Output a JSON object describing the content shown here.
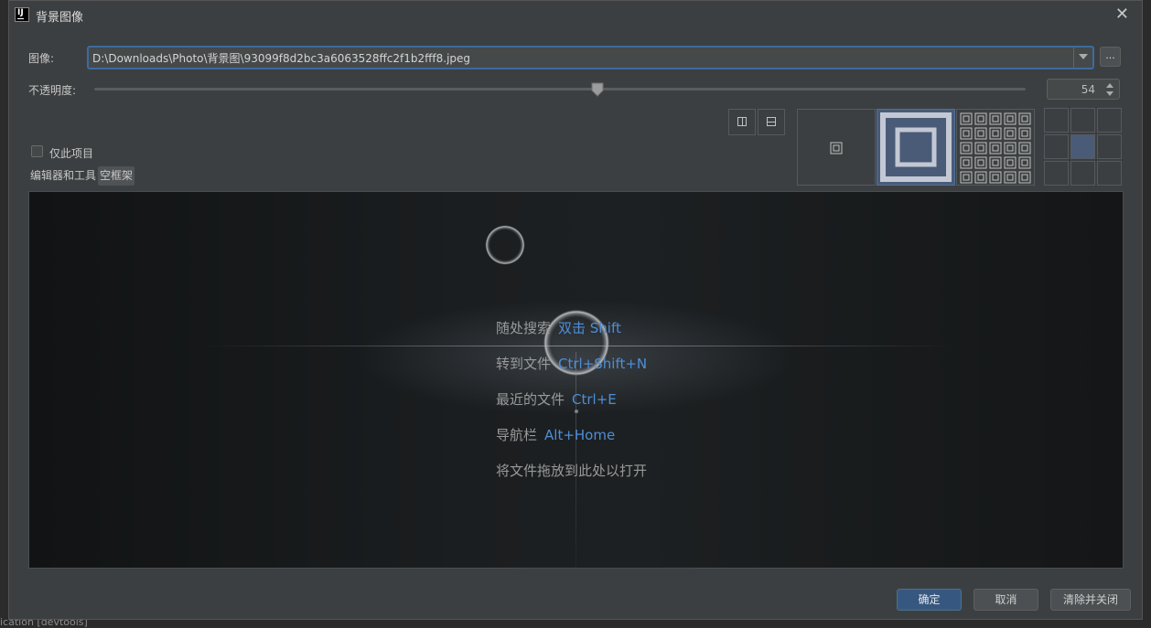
{
  "dialog": {
    "title": "背景图像",
    "image_label": "图像:",
    "image_path": "D:\\Downloads\\Photo\\背景图\\93099f8d2bc3a6063528ffc2f1b2fff8.jpeg",
    "browse_label": "...",
    "opacity_label": "不透明度:",
    "opacity_value": "54",
    "opacity_fraction": 0.54,
    "this_project_only_label": "仅此项目",
    "this_project_only_checked": false,
    "tabs": [
      {
        "label": "编辑器和工具",
        "selected": false
      },
      {
        "label": "空框架",
        "selected": true
      }
    ],
    "fill_options": [
      "center",
      "scale",
      "tile"
    ],
    "selected_fill": "scale",
    "anchor_selected": "center",
    "accent_color": "#4d8ed6",
    "selection_color": "#4a5b78"
  },
  "preview": {
    "hints": [
      {
        "text": "随处搜索",
        "key": "双击 Shift"
      },
      {
        "text": "转到文件",
        "key": "Ctrl+Shift+N"
      },
      {
        "text": "最近的文件",
        "key": "Ctrl+E"
      },
      {
        "text": "导航栏",
        "key": "Alt+Home"
      },
      {
        "text": "将文件拖放到此处以打开",
        "key": ""
      }
    ]
  },
  "buttons": {
    "ok": "确定",
    "cancel": "取消",
    "clear_close": "清除并关闭"
  },
  "background": {
    "bottom_text": "ication [devtools]"
  }
}
